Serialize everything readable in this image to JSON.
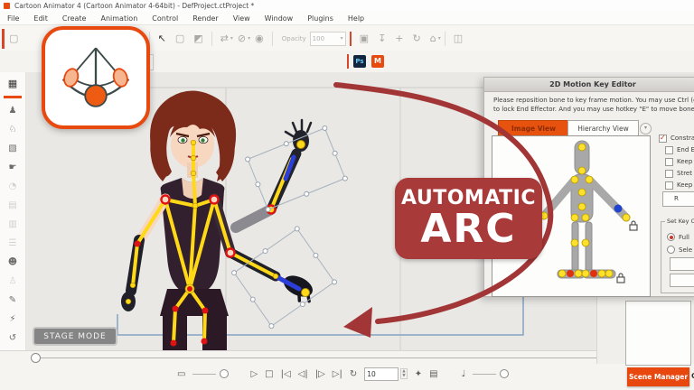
{
  "titlebar": {
    "title": "Cartoon Animator 4  (Cartoon Animator 4-64bit) - DefProject.ctProject *"
  },
  "menubar": {
    "items": [
      "File",
      "Edit",
      "Create",
      "Animation",
      "Control",
      "Render",
      "View",
      "Window",
      "Plugins",
      "Help"
    ]
  },
  "toolbar": {
    "caret": "▾",
    "opacity_label": "Opacity",
    "opacity_value": "100",
    "ps": "Ps",
    "m": "M",
    "row1": [
      {
        "name": "new-project-icon",
        "glyph": "▢"
      },
      {
        "name": "redo-icon",
        "glyph": "↷"
      },
      {
        "name": "select-tool-icon",
        "glyph": "↖"
      },
      {
        "name": "page-icon",
        "glyph": "▢"
      },
      {
        "name": "fill-tool-icon",
        "glyph": "◩"
      },
      {
        "name": "flip-icon",
        "glyph": "⇄"
      },
      {
        "name": "link-icon",
        "glyph": "⊘"
      },
      {
        "name": "visibility-icon",
        "glyph": "◉"
      },
      {
        "name": "image-icon",
        "glyph": "▣"
      },
      {
        "name": "pin-down-icon",
        "glyph": "↧"
      },
      {
        "name": "move-icon",
        "glyph": "+"
      },
      {
        "name": "rotate-icon",
        "glyph": "↻"
      },
      {
        "name": "home-icon",
        "glyph": "⌂"
      },
      {
        "name": "mirror-icon",
        "glyph": "◫"
      }
    ]
  },
  "sidebar": {
    "items": [
      {
        "name": "content-manager-icon",
        "glyph": "▦"
      },
      {
        "name": "actor-icon",
        "glyph": "♟"
      },
      {
        "name": "animation-icon",
        "glyph": "♘"
      },
      {
        "name": "props-icon",
        "glyph": "▧"
      },
      {
        "name": "gesture-icon",
        "glyph": "☛"
      },
      {
        "name": "help-icon",
        "glyph": "◔"
      },
      {
        "name": "template-grid-icon",
        "glyph": "▤"
      },
      {
        "name": "template-grid2-icon",
        "glyph": "▥"
      },
      {
        "name": "adjust-icon",
        "glyph": "☰"
      },
      {
        "name": "face-puppet-icon",
        "glyph": "☻"
      },
      {
        "name": "body-puppet-icon",
        "glyph": "♙"
      },
      {
        "name": "face-key-icon",
        "glyph": "✎"
      },
      {
        "name": "motion-icon",
        "glyph": "⚡"
      },
      {
        "name": "head-turn-icon",
        "glyph": "↺"
      },
      {
        "name": "layer-grid-icon",
        "glyph": "▦"
      },
      {
        "name": "layer-manager-icon",
        "glyph": "▣"
      }
    ]
  },
  "stage": {
    "mode_label": "STAGE MODE"
  },
  "arc_badge": {
    "line1": "AUTOMATIC",
    "line2": "ARC",
    "bg_color": "#a93a3a"
  },
  "key_editor": {
    "title": "2D Motion Key Editor",
    "instructions": [
      "Please reposition bone to key frame motion. You may use Ctrl (or Cmd) + Left Mo",
      "to lock End Effector. And you may use hotkey \"E\" to move bone independently."
    ],
    "tabs": [
      "Image View",
      "Hierarchy View"
    ],
    "active_tab": "Image View",
    "check_glyph": "✓",
    "checkboxes": [
      {
        "label": "Constra",
        "checked": true
      },
      {
        "label": "End E",
        "checked": false
      },
      {
        "label": "Keep",
        "checked": false
      },
      {
        "label": "Stret",
        "checked": false
      },
      {
        "label": "Keep",
        "checked": false
      }
    ],
    "reset_button": "R",
    "set_key_group": "Set Key O",
    "radios": [
      {
        "label": "Full",
        "selected": true
      },
      {
        "label": "Sele",
        "selected": false
      }
    ]
  },
  "playback": {
    "frame_value": "10",
    "caption_glyph": "▭",
    "note_glyph": "♩",
    "gear_glyph": "✦",
    "export_glyph": "▤",
    "buttons": [
      {
        "name": "play-button",
        "glyph": "▷"
      },
      {
        "name": "stop-button",
        "glyph": "□"
      },
      {
        "name": "go-first-button",
        "glyph": "|◁"
      },
      {
        "name": "prev-frame-button",
        "glyph": "◁|"
      },
      {
        "name": "next-frame-button",
        "glyph": "|▷"
      },
      {
        "name": "go-last-button",
        "glyph": "▷|"
      },
      {
        "name": "loop-button",
        "glyph": "↻"
      }
    ]
  },
  "footer": {
    "scene_manager": "Scene Manager",
    "partial_button": "C"
  },
  "colors": {
    "accent_orange": "#e8490f",
    "badge_red": "#a93a3a",
    "bone_yellow": "#ffd918",
    "joint_red": "#e01212",
    "bone_blue": "#2b3ed8"
  }
}
